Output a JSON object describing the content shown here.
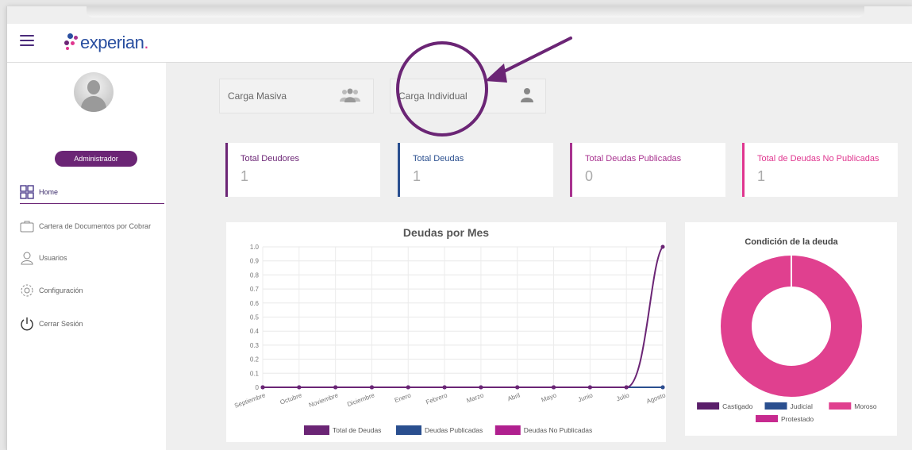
{
  "header": {
    "logo_text": "experian",
    "logo_dot": "."
  },
  "sidebar": {
    "role": "Administrador",
    "items": [
      {
        "label": "Home",
        "icon": "grid-icon"
      },
      {
        "label": "Cartera de Documentos por Cobrar",
        "icon": "briefcase-icon"
      },
      {
        "label": "Usuarios",
        "icon": "user-icon"
      },
      {
        "label": "Configuración",
        "icon": "gear-icon"
      },
      {
        "label": "Cerrar Sesión",
        "icon": "power-icon"
      }
    ]
  },
  "upload": {
    "bulk_label": "Carga Masiva",
    "single_label": "Carga Individual"
  },
  "stats": [
    {
      "title": "Total Deudores",
      "value": "1",
      "color": "#6b2575"
    },
    {
      "title": "Total Deudas",
      "value": "1",
      "color": "#2a4f8f"
    },
    {
      "title": "Total Deudas Publicadas",
      "value": "0",
      "color": "#a8328f"
    },
    {
      "title": "Total de Deudas No Publicadas",
      "value": "1",
      "color": "#e0368f"
    }
  ],
  "chart_data": [
    {
      "type": "line",
      "title": "Deudas por Mes",
      "categories": [
        "Septiembre",
        "Octubre",
        "Noviembre",
        "Diciembre",
        "Enero",
        "Febrero",
        "Marzo",
        "Abril",
        "Mayo",
        "Junio",
        "Julio",
        "Agosto"
      ],
      "ylim": [
        0,
        1.0
      ],
      "yticks": [
        "0",
        "0.1",
        "0.2",
        "0.3",
        "0.4",
        "0.5",
        "0.6",
        "0.7",
        "0.8",
        "0.9",
        "1.0"
      ],
      "grid": true,
      "legend_position": "bottom",
      "series": [
        {
          "name": "Total de Deudas",
          "color": "#6b2575",
          "values": [
            0,
            0,
            0,
            0,
            0,
            0,
            0,
            0,
            0,
            0,
            0,
            1
          ]
        },
        {
          "name": "Deudas Publicadas",
          "color": "#2a4f8f",
          "values": [
            0,
            0,
            0,
            0,
            0,
            0,
            0,
            0,
            0,
            0,
            0,
            0
          ]
        },
        {
          "name": "Deudas No Publicadas",
          "color": "#b0208f",
          "values": [
            0,
            0,
            0,
            0,
            0,
            0,
            0,
            0,
            0,
            0,
            0,
            0
          ]
        }
      ]
    },
    {
      "type": "pie",
      "title": "Condición de la deuda",
      "legend_position": "bottom",
      "categories": [
        "Castigado",
        "Judicial",
        "Moroso",
        "Protestado"
      ],
      "colors": [
        "#5a1e6a",
        "#2a4f8f",
        "#e0408f",
        "#c72a8f"
      ],
      "values": [
        0,
        0,
        1,
        0
      ]
    }
  ]
}
